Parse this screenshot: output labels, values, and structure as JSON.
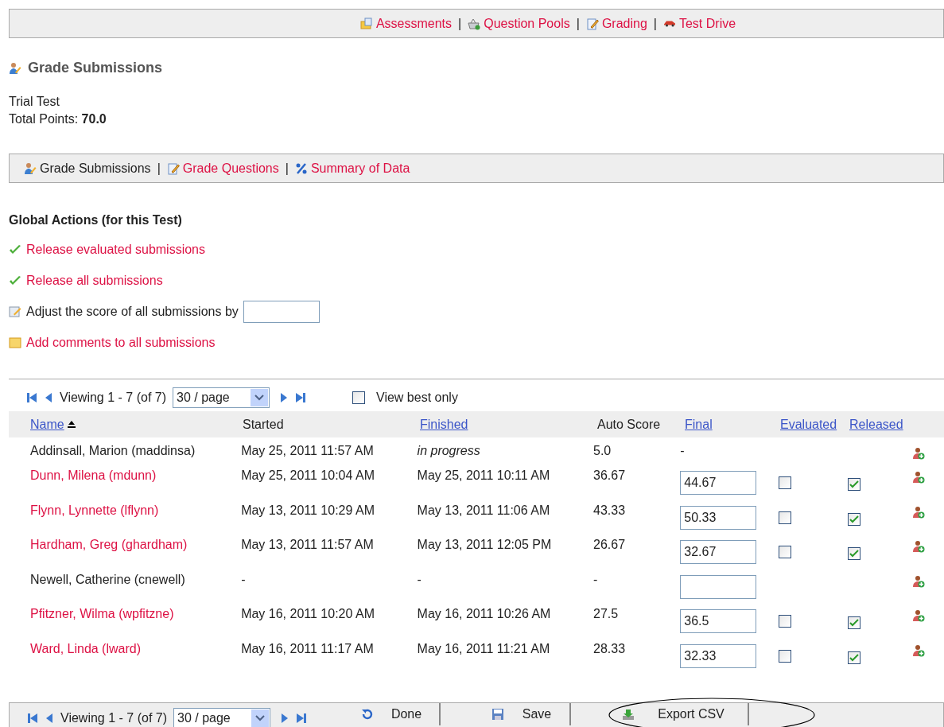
{
  "top_nav": {
    "separator": "|",
    "items": [
      {
        "label": "Assessments"
      },
      {
        "label": "Question Pools"
      },
      {
        "label": "Grading"
      },
      {
        "label": "Test Drive"
      }
    ]
  },
  "title": "Grade Submissions",
  "test_name": "Trial Test",
  "total_points": {
    "label": "Total Points:",
    "value": "70.0"
  },
  "sub_nav": {
    "separator": "|",
    "items": [
      {
        "label": "Grade Submissions",
        "selected": true
      },
      {
        "label": "Grade Questions",
        "selected": false
      },
      {
        "label": "Summary of Data",
        "selected": false
      }
    ]
  },
  "global_actions": {
    "title": "Global Actions (for this Test)",
    "items": [
      {
        "kind": "link",
        "label": "Release evaluated submissions"
      },
      {
        "kind": "link",
        "label": "Release all submissions"
      },
      {
        "kind": "field",
        "label": "Adjust the score of all submissions by"
      },
      {
        "kind": "link",
        "label": "Add comments to all submissions"
      }
    ]
  },
  "pager_top": {
    "viewing": "Viewing 1 - 7 (of 7)",
    "per_page": "30 / page",
    "view_best_only": {
      "label": "View best only",
      "checked": false
    }
  },
  "table": {
    "columns": [
      {
        "label": "Name",
        "link": true,
        "sorted": true
      },
      {
        "label": "Started",
        "link": false
      },
      {
        "label": "Finished",
        "link": true
      },
      {
        "label": "Auto Score",
        "link": false
      },
      {
        "label": "Final",
        "link": true
      },
      {
        "label": "Evaluated",
        "link": true
      },
      {
        "label": "Released",
        "link": true
      }
    ],
    "rows": [
      {
        "name": "Addinsall, Marion (maddinsa)",
        "link": false,
        "started": "May 25, 2011 11:57 AM",
        "finished": "in progress",
        "finished_italic": true,
        "auto_score": "5.0",
        "final": {
          "kind": "text",
          "value": "-"
        }
      },
      {
        "name": "Dunn, Milena (mdunn)",
        "link": true,
        "started": "May 25, 2011 10:04 AM",
        "finished": "May 25, 2011 10:11 AM",
        "finished_italic": false,
        "auto_score": "36.67",
        "final": {
          "kind": "field",
          "value": "44.67"
        },
        "evaluated": false,
        "released": true
      },
      {
        "name": "Flynn, Lynnette (lflynn)",
        "link": true,
        "started": "May 13, 2011 10:29 AM",
        "finished": "May 13, 2011 11:06 AM",
        "finished_italic": false,
        "auto_score": "43.33",
        "final": {
          "kind": "field",
          "value": "50.33"
        },
        "evaluated": false,
        "released": true
      },
      {
        "name": "Hardham, Greg (ghardham)",
        "link": true,
        "started": "May 13, 2011 11:57 AM",
        "finished": "May 13, 2011 12:05 PM",
        "finished_italic": false,
        "auto_score": "26.67",
        "final": {
          "kind": "field",
          "value": "32.67"
        },
        "evaluated": false,
        "released": true
      },
      {
        "name": "Newell, Catherine (cnewell)",
        "link": false,
        "started": "-",
        "finished": "-",
        "finished_italic": false,
        "auto_score": "-",
        "final": {
          "kind": "field"
        }
      },
      {
        "name": "Pfitzner, Wilma (wpfitzne)",
        "link": true,
        "started": "May 16, 2011 10:20 AM",
        "finished": "May 16, 2011 10:26 AM",
        "finished_italic": false,
        "auto_score": "27.5",
        "final": {
          "kind": "field",
          "value": "36.5"
        },
        "evaluated": false,
        "released": true
      },
      {
        "name": "Ward, Linda (lward)",
        "link": true,
        "started": "May 16, 2011 11:17 AM",
        "finished": "May 16, 2011 11:21 AM",
        "finished_italic": false,
        "auto_score": "28.33",
        "final": {
          "kind": "field",
          "value": "32.33"
        },
        "evaluated": false,
        "released": true
      }
    ]
  },
  "pager_bottom": {
    "viewing": "Viewing 1 - 7 (of 7)",
    "per_page": "30 / page"
  },
  "buttons": [
    {
      "label": "Done",
      "highlighted": false
    },
    {
      "label": "Save",
      "highlighted": false
    },
    {
      "label": "Export CSV",
      "highlighted": true
    }
  ]
}
